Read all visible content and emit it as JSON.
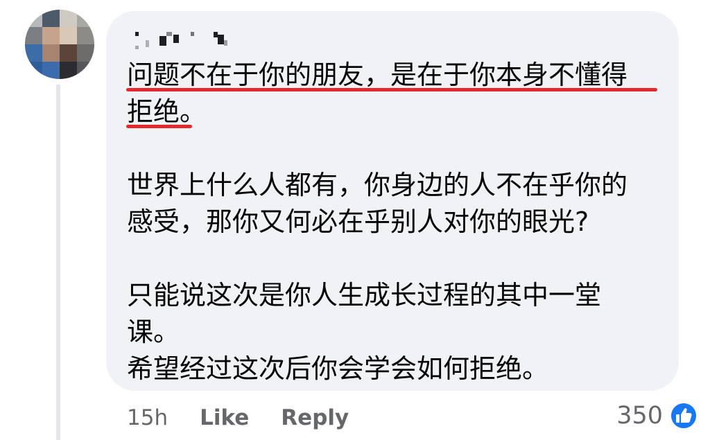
{
  "comment": {
    "paragraphs": [
      [
        "问题不在于你的朋友，是在于你本身不懂得",
        "拒绝。"
      ],
      [
        "世界上什么人都有，你身边的人不在乎你的",
        "感受，那你又何必在乎别人对你的眼光?"
      ],
      [
        "只能说这次是你人生成长过程的其中一堂",
        "课。",
        "希望经过这次后你会学会如何拒绝。"
      ]
    ],
    "highlight_color": "#e4282c"
  },
  "footer": {
    "timestamp": "15h",
    "like_label": "Like",
    "reply_label": "Reply"
  },
  "reactions": {
    "count": "350",
    "icon": "thumbs-up-icon",
    "icon_color": "#1877f2"
  },
  "author": {
    "avatar_icon": "pixelated-avatar",
    "name_obscured": true
  }
}
